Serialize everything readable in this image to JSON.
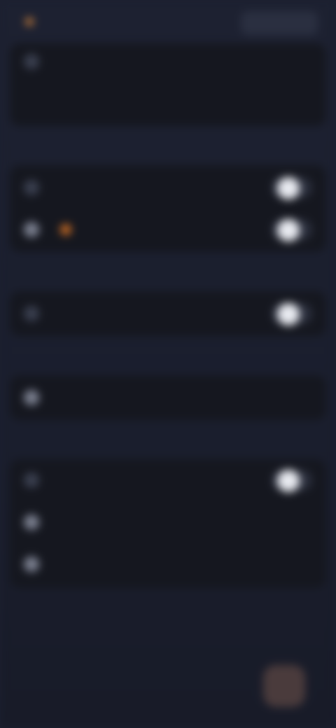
{
  "header": {
    "brand_title": "",
    "action_label": ""
  },
  "account": {
    "row1_label": "",
    "row2_label": "",
    "row2_trailing": ""
  },
  "sections": {
    "s1_title": "",
    "s2_title": "",
    "s3_title": "",
    "s4_title": ""
  },
  "settings": {
    "row_a_label": "",
    "row_b_label": "",
    "row_c_label": "",
    "row_d_label": "",
    "row_e_label": "",
    "row_f_label": "",
    "row_g_label": "",
    "row_g_trailing": ""
  },
  "footer": {
    "link_text": ""
  },
  "nav": {
    "items": [
      "",
      "",
      "",
      "",
      ""
    ]
  },
  "colors": {
    "background": "#1c2030",
    "card": "#15171f",
    "toggle_knob": "#e8eaf0",
    "accent": "#c76a23",
    "nav_active": "#4a3b3c"
  },
  "icons": [
    "brand-dot",
    "row-icon",
    "toggle",
    "badge-dot",
    "nav-icon"
  ]
}
